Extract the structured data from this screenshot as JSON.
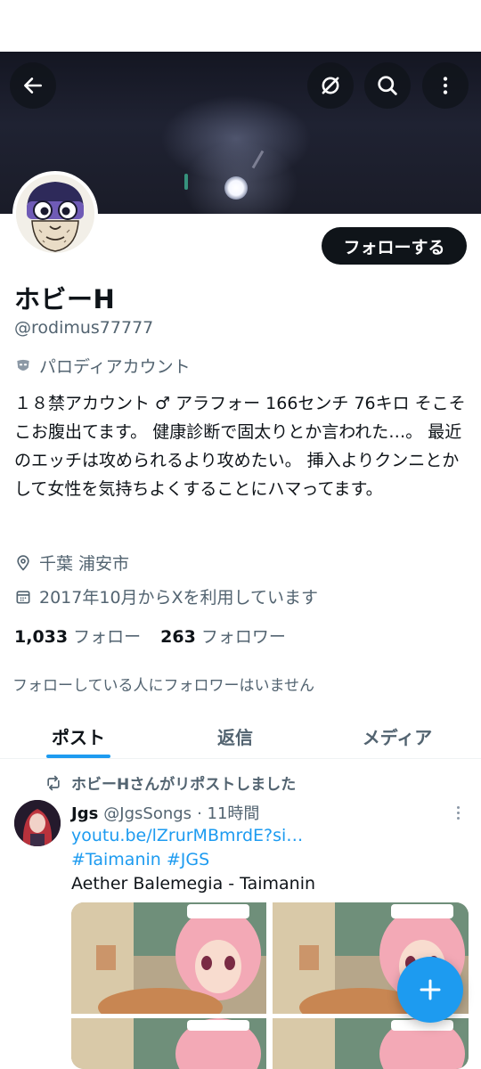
{
  "header": {
    "back_icon": "arrow-left-icon",
    "grok_icon": "slashed-circle-icon",
    "search_icon": "search-icon",
    "more_icon": "vertical-dots-icon"
  },
  "profile": {
    "follow_label": "フォローする",
    "display_name": "ホビーH",
    "handle": "@rodimus77777",
    "label_text": "パロディアカウント",
    "bio": "１８禁アカウント ♂ アラフォー 166センチ 76キロ そこそこお腹出てます。 健康診断で固太りとか言われた…。 最近のエッチは攻められるより攻めたい。 挿入よりクンニとかして女性を気持ちよくすることにハマってます。",
    "location": "千葉 浦安市",
    "joined": "2017年10月からXを利用しています",
    "following_count": "1,033",
    "following_label": "フォロー",
    "followers_count": "263",
    "followers_label": "フォロワー",
    "mutual_note": "フォローしている人にフォロワーはいません"
  },
  "tabs": [
    {
      "label": "ポスト",
      "active": true
    },
    {
      "label": "返信",
      "active": false
    },
    {
      "label": "メディア",
      "active": false
    }
  ],
  "post": {
    "repost_text": "ホビーHさんがリポストしました",
    "author_name": "Jgs",
    "author_handle": "@JgsSongs",
    "time": "· 11時間",
    "link": "youtu.be/lZrurMBmrdE?si…",
    "hashtags": "#Taimanin #JGS",
    "text": "Aether Balemegia - Taimanin"
  },
  "colors": {
    "accent": "#1d9bf0",
    "text_primary": "#0f1419",
    "text_secondary": "#536471",
    "button_dark": "#0f1419"
  },
  "fab": {
    "icon": "plus-icon"
  }
}
